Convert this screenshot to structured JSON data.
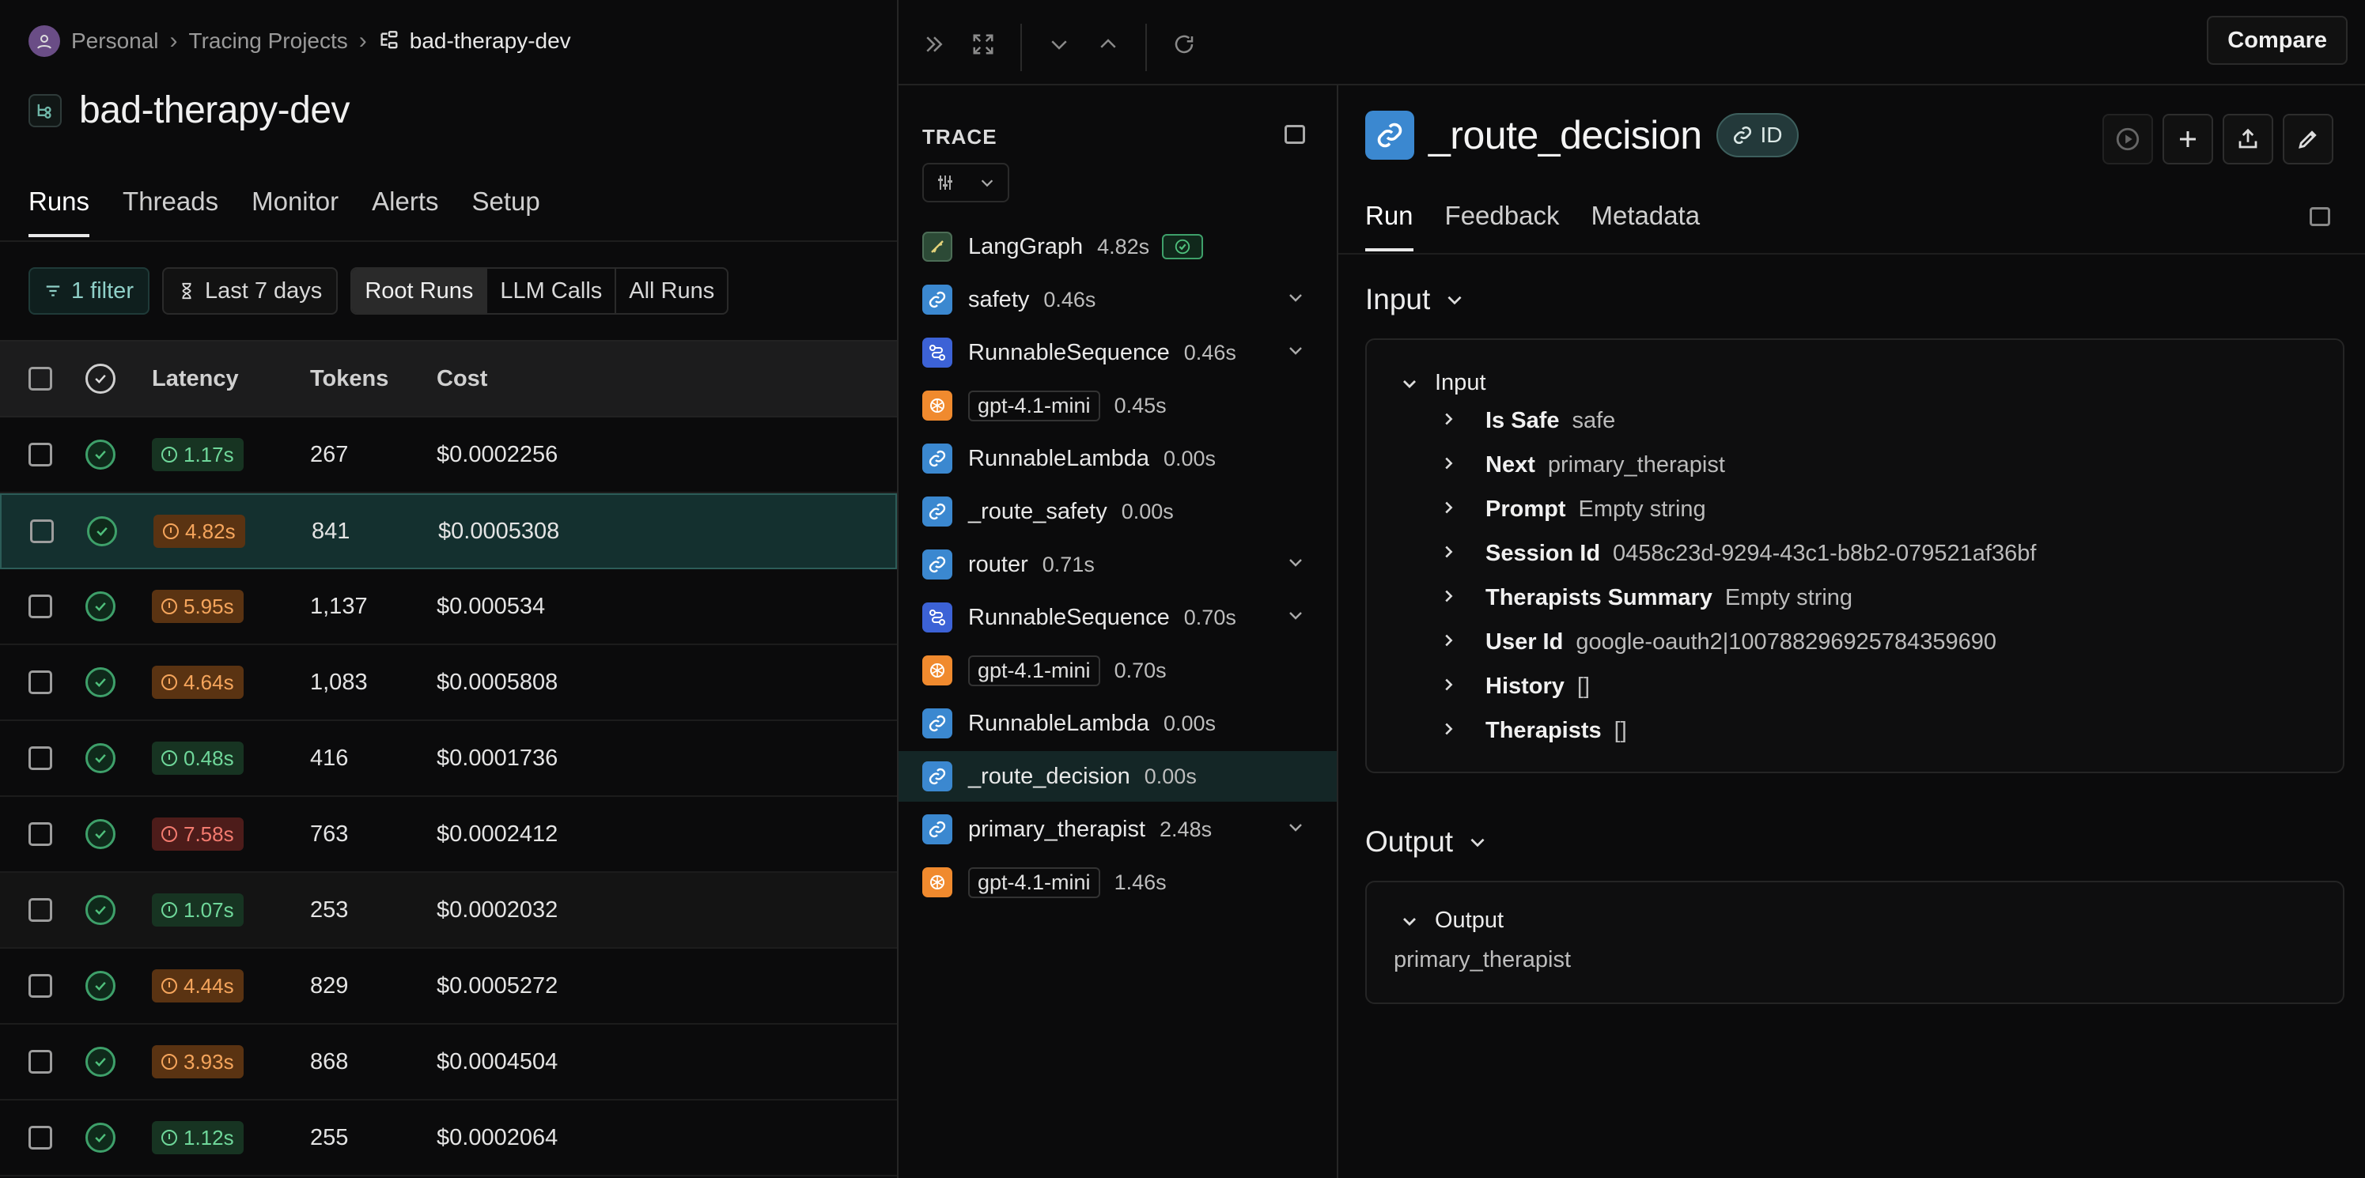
{
  "breadcrumb": {
    "workspace": "Personal",
    "section": "Tracing Projects",
    "project": "bad-therapy-dev"
  },
  "project_title": "bad-therapy-dev",
  "tabs": [
    "Runs",
    "Threads",
    "Monitor",
    "Alerts",
    "Setup"
  ],
  "filters": {
    "filter_label": "1 filter",
    "date_range": "Last 7 days",
    "run_types": [
      "Root Runs",
      "LLM Calls",
      "All Runs"
    ]
  },
  "table": {
    "headers": {
      "latency": "Latency",
      "tokens": "Tokens",
      "cost": "Cost"
    },
    "rows": [
      {
        "latency": "1.17s",
        "level": "g",
        "tokens": "267",
        "cost": "$0.0002256"
      },
      {
        "latency": "4.82s",
        "level": "o",
        "tokens": "841",
        "cost": "$0.0005308"
      },
      {
        "latency": "5.95s",
        "level": "o",
        "tokens": "1,137",
        "cost": "$0.000534"
      },
      {
        "latency": "4.64s",
        "level": "o",
        "tokens": "1,083",
        "cost": "$0.0005808"
      },
      {
        "latency": "0.48s",
        "level": "g",
        "tokens": "416",
        "cost": "$0.0001736"
      },
      {
        "latency": "7.58s",
        "level": "r",
        "tokens": "763",
        "cost": "$0.0002412"
      },
      {
        "latency": "1.07s",
        "level": "g",
        "tokens": "253",
        "cost": "$0.0002032"
      },
      {
        "latency": "4.44s",
        "level": "o",
        "tokens": "829",
        "cost": "$0.0005272"
      },
      {
        "latency": "3.93s",
        "level": "o",
        "tokens": "868",
        "cost": "$0.0004504"
      },
      {
        "latency": "1.12s",
        "level": "g",
        "tokens": "255",
        "cost": "$0.0002064"
      }
    ]
  },
  "toolbar": {
    "compare": "Compare"
  },
  "trace": {
    "header": "TRACE",
    "nodes": [
      {
        "name": "LangGraph",
        "dur": "4.82s",
        "type": "lg"
      },
      {
        "name": "safety",
        "dur": "0.46s",
        "type": "chain"
      },
      {
        "name": "RunnableSequence",
        "dur": "0.46s",
        "type": "seq"
      },
      {
        "name": "gpt-4.1-mini",
        "dur": "0.45s",
        "type": "llm"
      },
      {
        "name": "RunnableLambda",
        "dur": "0.00s",
        "type": "chain"
      },
      {
        "name": "_route_safety",
        "dur": "0.00s",
        "type": "chain"
      },
      {
        "name": "router",
        "dur": "0.71s",
        "type": "chain"
      },
      {
        "name": "RunnableSequence",
        "dur": "0.70s",
        "type": "seq"
      },
      {
        "name": "gpt-4.1-mini",
        "dur": "0.70s",
        "type": "llm"
      },
      {
        "name": "RunnableLambda",
        "dur": "0.00s",
        "type": "chain"
      },
      {
        "name": "_route_decision",
        "dur": "0.00s",
        "type": "chain"
      },
      {
        "name": "primary_therapist",
        "dur": "2.48s",
        "type": "chain"
      },
      {
        "name": "gpt-4.1-mini",
        "dur": "1.46s",
        "type": "llm"
      }
    ]
  },
  "detail": {
    "title": "_route_decision",
    "id_label": "ID",
    "tabs": [
      "Run",
      "Feedback",
      "Metadata"
    ],
    "input_heading": "Input",
    "input_group": "Input",
    "input_fields": [
      {
        "key": "Is Safe",
        "value": "safe"
      },
      {
        "key": "Next",
        "value": "primary_therapist"
      },
      {
        "key": "Prompt",
        "value": "Empty string"
      },
      {
        "key": "Session Id",
        "value": "0458c23d-9294-43c1-b8b2-079521af36bf"
      },
      {
        "key": "Therapists Summary",
        "value": "Empty string"
      },
      {
        "key": "User Id",
        "value": "google-oauth2|100788296925784359690"
      },
      {
        "key": "History",
        "value": "[]"
      },
      {
        "key": "Therapists",
        "value": "[]"
      }
    ],
    "output_heading": "Output",
    "output_group": "Output",
    "output_value": "primary_therapist"
  }
}
